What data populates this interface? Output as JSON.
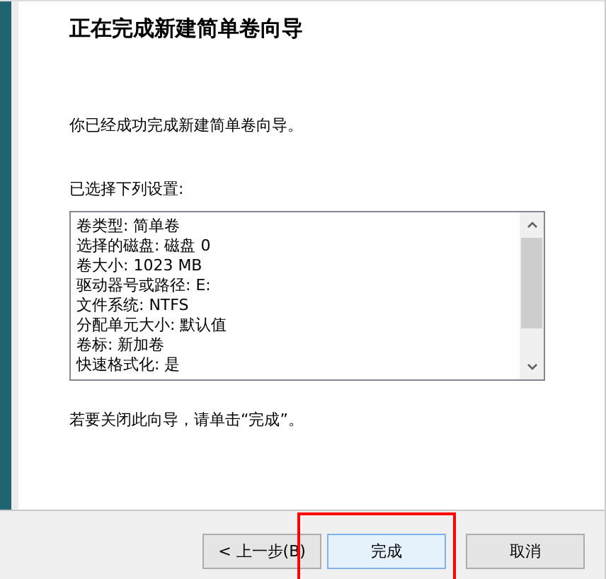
{
  "title": "正在完成新建简单卷向导",
  "message": "你已经成功完成新建简单卷向导。",
  "settings_label": "已选择下列设置:",
  "settings": [
    "卷类型: 简单卷",
    "选择的磁盘: 磁盘 0",
    "卷大小: 1023 MB",
    "驱动器号或路径: E:",
    "文件系统: NTFS",
    "分配单元大小: 默认值",
    "卷标: 新加卷",
    "快速格式化: 是"
  ],
  "close_hint": "若要关闭此向导，请单击“完成”。",
  "buttons": [
    {
      "label": "< 上一步(B)",
      "default": false
    },
    {
      "label": "完成",
      "default": true
    },
    {
      "label": "取消",
      "default": false
    }
  ],
  "highlight": {
    "on": true
  }
}
